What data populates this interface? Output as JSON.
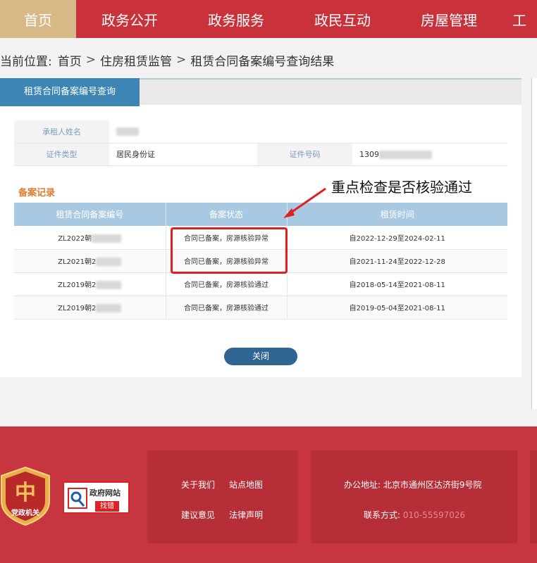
{
  "nav": {
    "items": [
      "首页",
      "政务公开",
      "政务服务",
      "政民互动",
      "房屋管理",
      "工"
    ]
  },
  "breadcrumb": {
    "prefix": "当前位置:",
    "items": [
      "首页",
      "住房租赁监管",
      "租赁合同备案编号查询结果"
    ],
    "separator": ">"
  },
  "panel": {
    "tab_label": "租赁合同备案编号查询"
  },
  "info": {
    "tenant_label": "承租人姓名",
    "tenant_value": "",
    "idtype_label": "证件类型",
    "idtype_value": "居民身份证",
    "idnum_label": "证件号码",
    "idnum_value": "1309"
  },
  "records": {
    "section_title": "备案记录",
    "headers": [
      "租赁合同备案编号",
      "备案状态",
      "租赁时间"
    ],
    "rows": [
      {
        "id": "ZL2022朝",
        "status": "合同已备案，房源核验异常",
        "period": "自2022-12-29至2024-02-11"
      },
      {
        "id": "ZL2021朝2",
        "status": "合同已备案，房源核验异常",
        "period": "自2021-11-24至2022-12-28"
      },
      {
        "id": "ZL2019朝2",
        "status": "合同已备案，房源核验通过",
        "period": "自2018-05-14至2021-08-11"
      },
      {
        "id": "ZL2019朝2",
        "status": "合同已备案，房源核验通过",
        "period": "自2019-05-04至2021-08-11"
      }
    ]
  },
  "annotation": {
    "text": "重点检查是否核验通过",
    "color": "#e0201f"
  },
  "actions": {
    "close_label": "关闭"
  },
  "footer": {
    "badge_text": "党政机关",
    "gov_top": "政府网站",
    "gov_bottom": "找错",
    "links": [
      "关于我们",
      "站点地图",
      "建议意见",
      "法律声明"
    ],
    "address_label": "办公地址:",
    "address_value": "北京市通州区达济街9号院",
    "phone_label": "联系方式:",
    "phone_value": "010-55597026"
  },
  "colors": {
    "brand_red": "#c9323b",
    "nav_active": "#d7b887",
    "tab_blue": "#3d85b5",
    "header_blue": "#a9c9e3",
    "button_blue": "#2f6593",
    "section_orange": "#e07b2e"
  }
}
